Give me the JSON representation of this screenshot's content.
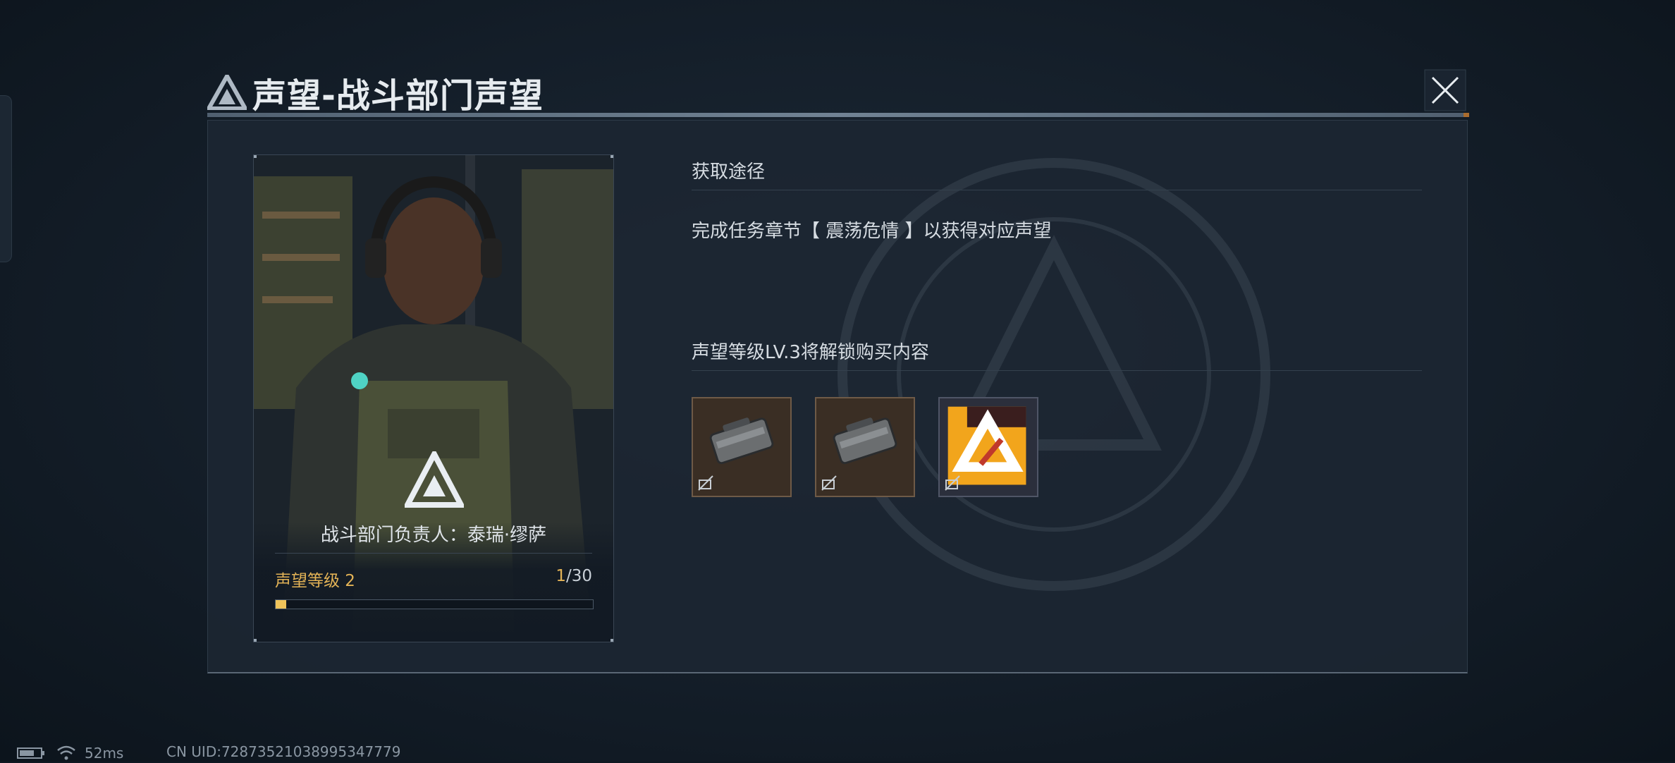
{
  "window": {
    "title": "声望-战斗部门声望"
  },
  "card": {
    "name": "战斗部门负责人：泰瑞·缪萨",
    "level_label": "声望等级 2",
    "progress_current": "1",
    "progress_total": "/30",
    "progress_fraction": 0.033
  },
  "acquire": {
    "title": "获取途径",
    "description": "完成任务章节【 震荡危情 】以获得对应声望"
  },
  "unlock": {
    "title": "声望等级LV.3将解锁购买内容",
    "items": [
      {
        "icon": "supply-case-icon"
      },
      {
        "icon": "supply-case-icon"
      },
      {
        "icon": "weapon-skin-icon"
      }
    ]
  },
  "status": {
    "ping": "52ms",
    "uid": "CN UID:72873521038995347779"
  },
  "colors": {
    "accent_gold": "#e3b356",
    "panel_bg": "#1c2632"
  }
}
